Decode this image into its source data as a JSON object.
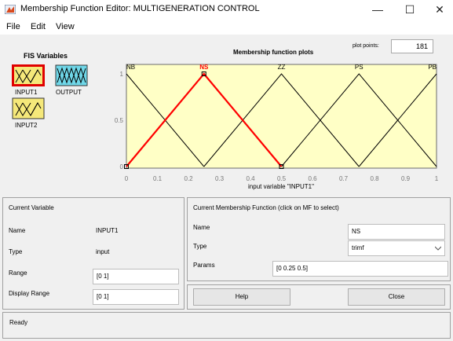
{
  "window": {
    "title": "Membership Function Editor: MULTIGENERATION CONTROL",
    "minimize": "—",
    "maximize": "☐",
    "close": "✕"
  },
  "menu": [
    "File",
    "Edit",
    "View"
  ],
  "fis_variables": {
    "title": "FIS Variables",
    "items": [
      {
        "label": "INPUT1",
        "selected": true,
        "color": "#f5e87a"
      },
      {
        "label": "OUTPUT",
        "selected": false,
        "color": "#6fd7e8"
      },
      {
        "label": "INPUT2",
        "selected": false,
        "color": "#f5e87a"
      }
    ]
  },
  "plot": {
    "title": "Membership function plots",
    "plot_points_label": "plot points:",
    "plot_points_value": "181",
    "xlabel": "input variable \"INPUT1\"",
    "background": "#ffffc6",
    "highlight_color": "#ff0000",
    "line_color": "#000000"
  },
  "chart_data": {
    "type": "line",
    "xlim": [
      0,
      1
    ],
    "ylim": [
      0,
      1
    ],
    "xticks": [
      "0",
      "0.1",
      "0.2",
      "0.3",
      "0.4",
      "0.5",
      "0.6",
      "0.7",
      "0.8",
      "0.9",
      "1"
    ],
    "yticks": [
      "0",
      "0.5",
      "1"
    ],
    "series": [
      {
        "name": "NB",
        "x": [
          -0.25,
          0,
          0.25
        ],
        "y": [
          0,
          1,
          0
        ],
        "selected": false
      },
      {
        "name": "NS",
        "x": [
          0,
          0.25,
          0.5
        ],
        "y": [
          0,
          1,
          0
        ],
        "selected": true
      },
      {
        "name": "ZZ",
        "x": [
          0.25,
          0.5,
          0.75
        ],
        "y": [
          0,
          1,
          0
        ],
        "selected": false
      },
      {
        "name": "PS",
        "x": [
          0.5,
          0.75,
          1
        ],
        "y": [
          0,
          1,
          0
        ],
        "selected": false
      },
      {
        "name": "PB",
        "x": [
          0.75,
          1,
          1.25
        ],
        "y": [
          0,
          1,
          0
        ],
        "selected": false
      }
    ]
  },
  "current_variable": {
    "title": "Current Variable",
    "name_label": "Name",
    "name_value": "INPUT1",
    "type_label": "Type",
    "type_value": "input",
    "range_label": "Range",
    "range_value": "[0 1]",
    "display_range_label": "Display Range",
    "display_range_value": "[0 1]"
  },
  "current_mf": {
    "title": "Current Membership Function (click on MF to select)",
    "name_label": "Name",
    "name_value": "NS",
    "type_label": "Type",
    "type_value": "trimf",
    "params_label": "Params",
    "params_value": "[0 0.25 0.5]"
  },
  "buttons": {
    "help": "Help",
    "close": "Close"
  },
  "status": "Ready"
}
